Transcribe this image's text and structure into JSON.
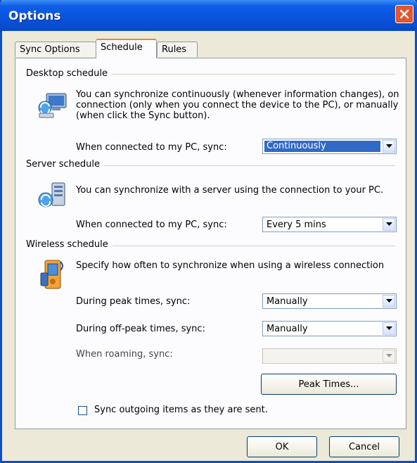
{
  "window": {
    "title": "Options"
  },
  "tabs": [
    {
      "label": "Sync Options"
    },
    {
      "label": "Schedule"
    },
    {
      "label": "Rules"
    }
  ],
  "desktop": {
    "title": "Desktop schedule",
    "desc": "You can synchronize continuously (whenever information changes), on connection (only when you connect the device to the PC), or manually (when click the Sync button).",
    "label": "When connected to my PC, sync:",
    "value": "Continuously",
    "icon": "desktop-sync-icon"
  },
  "server": {
    "title": "Server schedule",
    "desc": "You can synchronize with a server using the connection to your PC.",
    "label": "When connected to my PC, sync:",
    "value": "Every 5 mins",
    "icon": "server-sync-icon"
  },
  "wireless": {
    "title": "Wireless schedule",
    "desc": "Specify how often to synchronize when using a wireless connection",
    "peak_label": "During peak times, sync:",
    "peak_value": "Manually",
    "offpeak_label": "During off-peak times, sync:",
    "offpeak_value": "Manually",
    "roaming_label": "When roaming, sync:",
    "roaming_value": "",
    "peak_times_button": "Peak Times...",
    "checkbox_label": "Sync outgoing items as they are sent.",
    "checkbox_checked": false,
    "icon": "wireless-device-icon"
  },
  "buttons": {
    "ok": "OK",
    "cancel": "Cancel"
  },
  "colors": {
    "titlebar": "#0a52dc",
    "close": "#e2562e",
    "selection": "#316ac5",
    "tab_accent": "#e68b2c"
  }
}
